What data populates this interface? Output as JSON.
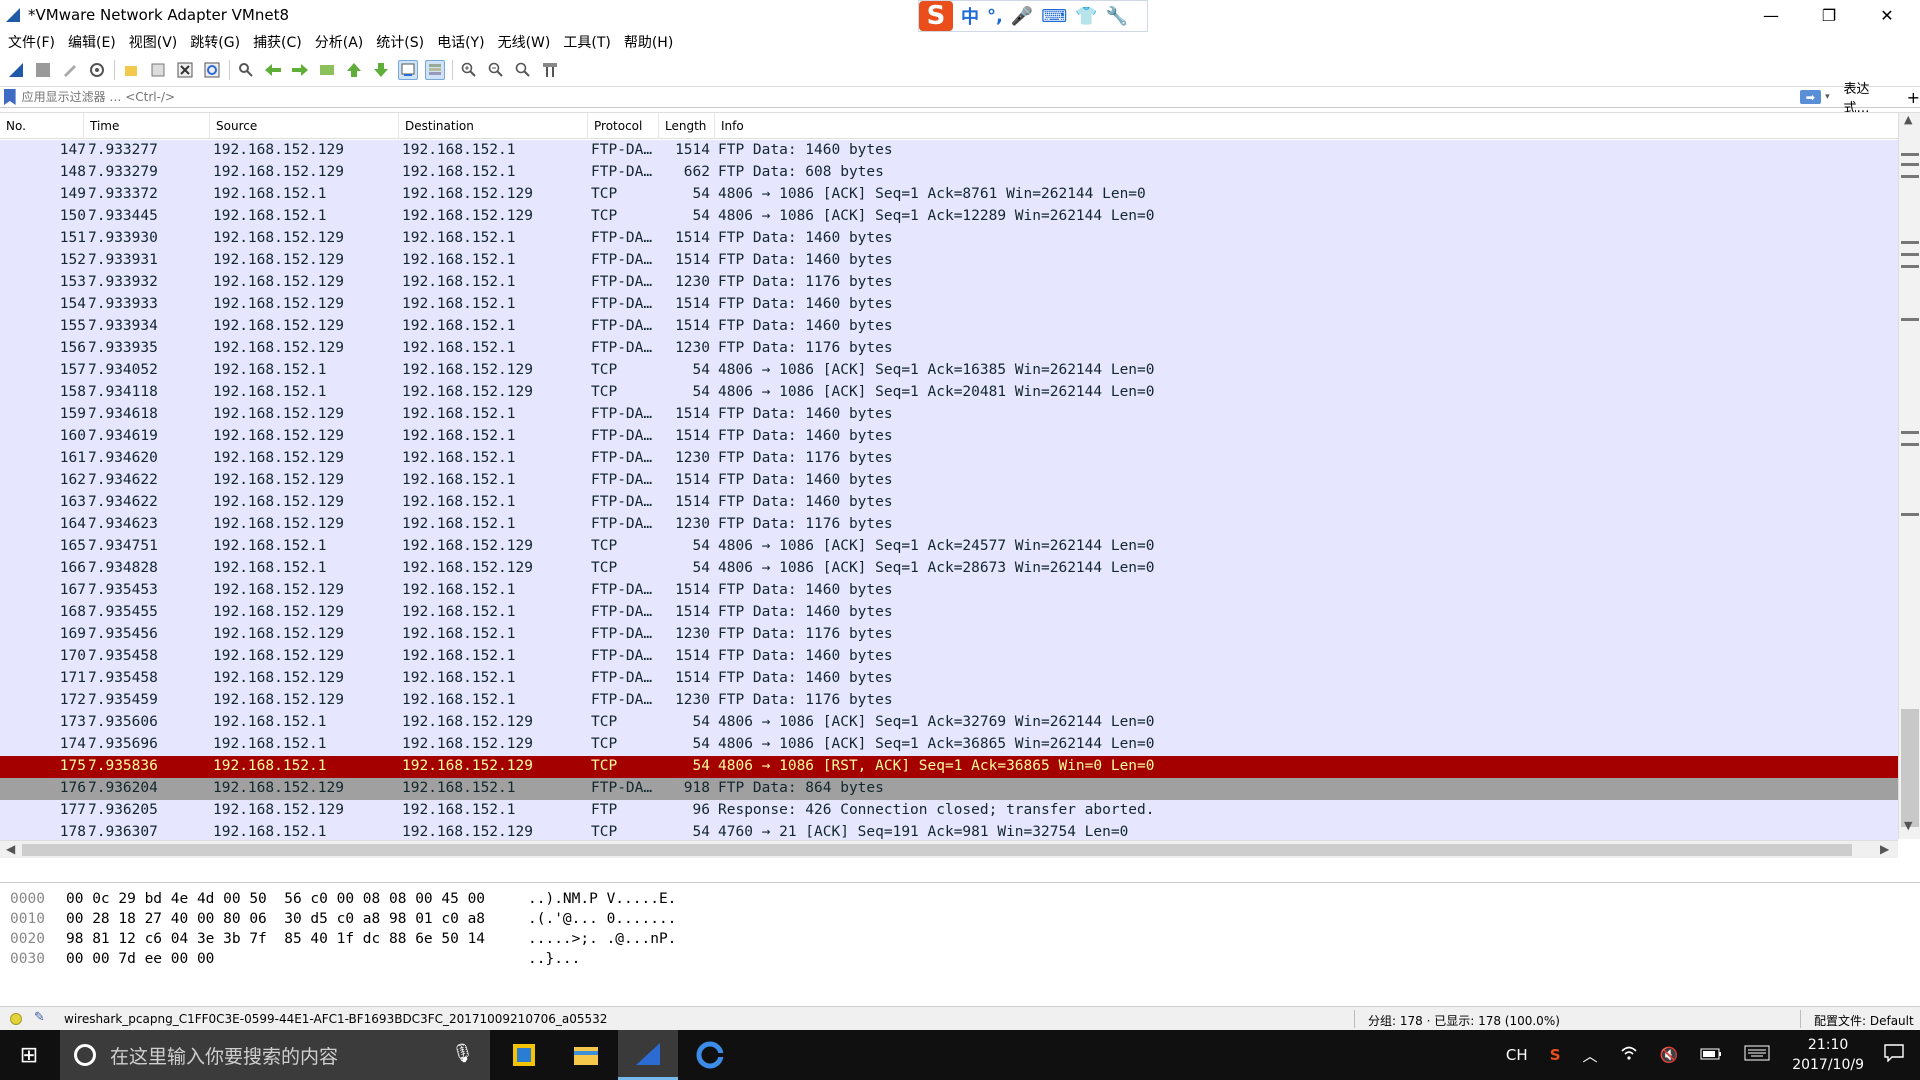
{
  "window": {
    "title": "*VMware Network Adapter VMnet8",
    "min_glyph": "—",
    "max_glyph": "❐",
    "close_glyph": "✕"
  },
  "ime": {
    "logo": "S",
    "mode": "中",
    "punct": "°,",
    "voice": "🎤",
    "keyboard": "⌨",
    "skin": "👕",
    "tools": "🔧"
  },
  "menu": [
    "文件(F)",
    "编辑(E)",
    "视图(V)",
    "跳转(G)",
    "捕获(C)",
    "分析(A)",
    "统计(S)",
    "电话(Y)",
    "无线(W)",
    "工具(T)",
    "帮助(H)"
  ],
  "filter": {
    "placeholder": "应用显示过滤器 … <Ctrl-/>",
    "apply_glyph": "➡",
    "dropdown_glyph": "▾",
    "expression_label": "表达式…",
    "add_glyph": "+"
  },
  "packet_list": {
    "columns": [
      "No.",
      "Time",
      "Source",
      "Destination",
      "Protocol",
      "Length",
      "Info"
    ],
    "rows": [
      [
        "147",
        "7.933277",
        "192.168.152.129",
        "192.168.152.1",
        "FTP-DA…",
        "1514",
        "FTP Data: 1460 bytes"
      ],
      [
        "148",
        "7.933279",
        "192.168.152.129",
        "192.168.152.1",
        "FTP-DA…",
        "662",
        "FTP Data: 608 bytes"
      ],
      [
        "149",
        "7.933372",
        "192.168.152.1",
        "192.168.152.129",
        "TCP",
        "54",
        "4806 → 1086 [ACK] Seq=1 Ack=8761 Win=262144 Len=0"
      ],
      [
        "150",
        "7.933445",
        "192.168.152.1",
        "192.168.152.129",
        "TCP",
        "54",
        "4806 → 1086 [ACK] Seq=1 Ack=12289 Win=262144 Len=0"
      ],
      [
        "151",
        "7.933930",
        "192.168.152.129",
        "192.168.152.1",
        "FTP-DA…",
        "1514",
        "FTP Data: 1460 bytes"
      ],
      [
        "152",
        "7.933931",
        "192.168.152.129",
        "192.168.152.1",
        "FTP-DA…",
        "1514",
        "FTP Data: 1460 bytes"
      ],
      [
        "153",
        "7.933932",
        "192.168.152.129",
        "192.168.152.1",
        "FTP-DA…",
        "1230",
        "FTP Data: 1176 bytes"
      ],
      [
        "154",
        "7.933933",
        "192.168.152.129",
        "192.168.152.1",
        "FTP-DA…",
        "1514",
        "FTP Data: 1460 bytes"
      ],
      [
        "155",
        "7.933934",
        "192.168.152.129",
        "192.168.152.1",
        "FTP-DA…",
        "1514",
        "FTP Data: 1460 bytes"
      ],
      [
        "156",
        "7.933935",
        "192.168.152.129",
        "192.168.152.1",
        "FTP-DA…",
        "1230",
        "FTP Data: 1176 bytes"
      ],
      [
        "157",
        "7.934052",
        "192.168.152.1",
        "192.168.152.129",
        "TCP",
        "54",
        "4806 → 1086 [ACK] Seq=1 Ack=16385 Win=262144 Len=0"
      ],
      [
        "158",
        "7.934118",
        "192.168.152.1",
        "192.168.152.129",
        "TCP",
        "54",
        "4806 → 1086 [ACK] Seq=1 Ack=20481 Win=262144 Len=0"
      ],
      [
        "159",
        "7.934618",
        "192.168.152.129",
        "192.168.152.1",
        "FTP-DA…",
        "1514",
        "FTP Data: 1460 bytes"
      ],
      [
        "160",
        "7.934619",
        "192.168.152.129",
        "192.168.152.1",
        "FTP-DA…",
        "1514",
        "FTP Data: 1460 bytes"
      ],
      [
        "161",
        "7.934620",
        "192.168.152.129",
        "192.168.152.1",
        "FTP-DA…",
        "1230",
        "FTP Data: 1176 bytes"
      ],
      [
        "162",
        "7.934622",
        "192.168.152.129",
        "192.168.152.1",
        "FTP-DA…",
        "1514",
        "FTP Data: 1460 bytes"
      ],
      [
        "163",
        "7.934622",
        "192.168.152.129",
        "192.168.152.1",
        "FTP-DA…",
        "1514",
        "FTP Data: 1460 bytes"
      ],
      [
        "164",
        "7.934623",
        "192.168.152.129",
        "192.168.152.1",
        "FTP-DA…",
        "1230",
        "FTP Data: 1176 bytes"
      ],
      [
        "165",
        "7.934751",
        "192.168.152.1",
        "192.168.152.129",
        "TCP",
        "54",
        "4806 → 1086 [ACK] Seq=1 Ack=24577 Win=262144 Len=0"
      ],
      [
        "166",
        "7.934828",
        "192.168.152.1",
        "192.168.152.129",
        "TCP",
        "54",
        "4806 → 1086 [ACK] Seq=1 Ack=28673 Win=262144 Len=0"
      ],
      [
        "167",
        "7.935453",
        "192.168.152.129",
        "192.168.152.1",
        "FTP-DA…",
        "1514",
        "FTP Data: 1460 bytes"
      ],
      [
        "168",
        "7.935455",
        "192.168.152.129",
        "192.168.152.1",
        "FTP-DA…",
        "1514",
        "FTP Data: 1460 bytes"
      ],
      [
        "169",
        "7.935456",
        "192.168.152.129",
        "192.168.152.1",
        "FTP-DA…",
        "1230",
        "FTP Data: 1176 bytes"
      ],
      [
        "170",
        "7.935458",
        "192.168.152.129",
        "192.168.152.1",
        "FTP-DA…",
        "1514",
        "FTP Data: 1460 bytes"
      ],
      [
        "171",
        "7.935458",
        "192.168.152.129",
        "192.168.152.1",
        "FTP-DA…",
        "1514",
        "FTP Data: 1460 bytes"
      ],
      [
        "172",
        "7.935459",
        "192.168.152.129",
        "192.168.152.1",
        "FTP-DA…",
        "1230",
        "FTP Data: 1176 bytes"
      ],
      [
        "173",
        "7.935606",
        "192.168.152.1",
        "192.168.152.129",
        "TCP",
        "54",
        "4806 → 1086 [ACK] Seq=1 Ack=32769 Win=262144 Len=0"
      ],
      [
        "174",
        "7.935696",
        "192.168.152.1",
        "192.168.152.129",
        "TCP",
        "54",
        "4806 → 1086 [ACK] Seq=1 Ack=36865 Win=262144 Len=0"
      ],
      [
        "175",
        "7.935836",
        "192.168.152.1",
        "192.168.152.129",
        "TCP",
        "54",
        "4806 → 1086 [RST, ACK] Seq=1 Ack=36865 Win=0 Len=0"
      ],
      [
        "176",
        "7.936204",
        "192.168.152.129",
        "192.168.152.1",
        "FTP-DA…",
        "918",
        "FTP Data: 864 bytes"
      ],
      [
        "177",
        "7.936205",
        "192.168.152.129",
        "192.168.152.1",
        "FTP",
        "96",
        "Response: 426 Connection closed; transfer aborted."
      ],
      [
        "178",
        "7.936307",
        "192.168.152.1",
        "192.168.152.129",
        "TCP",
        "54",
        "4760 → 21 [ACK] Seq=191 Ack=981 Win=32754 Len=0"
      ]
    ],
    "row_styles": {
      "default": {
        "bg": "#e7e6ff",
        "fg": "#12272e"
      },
      "175": {
        "bg": "#a40000",
        "fg": "#fffc9c"
      },
      "176": {
        "bg": "#a0a0a0",
        "fg": "#12272e"
      },
      "177": {
        "bg": "#e7e6ff",
        "fg": "#12272e"
      },
      "178": {
        "bg": "#e7e6ff",
        "fg": "#12272e"
      }
    }
  },
  "bytes": [
    {
      "offset": "0000",
      "hex": "00 0c 29 bd 4e 4d 00 50  56 c0 00 08 08 00 45 00",
      "ascii": "..).NM.P V.....E."
    },
    {
      "offset": "0010",
      "hex": "00 28 18 27 40 00 80 06  30 d5 c0 a8 98 01 c0 a8",
      "ascii": ".(.'@... 0......."
    },
    {
      "offset": "0020",
      "hex": "98 81 12 c6 04 3e 3b 7f  85 40 1f dc 88 6e 50 14",
      "ascii": ".....>;. .@...nP."
    },
    {
      "offset": "0030",
      "hex": "00 00 7d ee 00 00",
      "ascii": "..}..."
    }
  ],
  "status": {
    "file": "wireshark_pcapng_C1FF0C3E-0599-44E1-AFC1-BF1693BDC3FC_20171009210706_a05532",
    "packets": "分组: 178 · 已显示: 178 (100.0%)",
    "profile": "配置文件: Default",
    "edit_glyph": "✎"
  },
  "taskbar": {
    "search_placeholder": "在这里输入你要搜索的内容",
    "start_glyph": "⊞",
    "mic_glyph": "🎙",
    "tray_lang": "CH",
    "time": "21:10",
    "date": "2017/10/9"
  },
  "colors": {
    "selected_row_bg": "#a40000",
    "selected_row_fg": "#fffc9c"
  }
}
